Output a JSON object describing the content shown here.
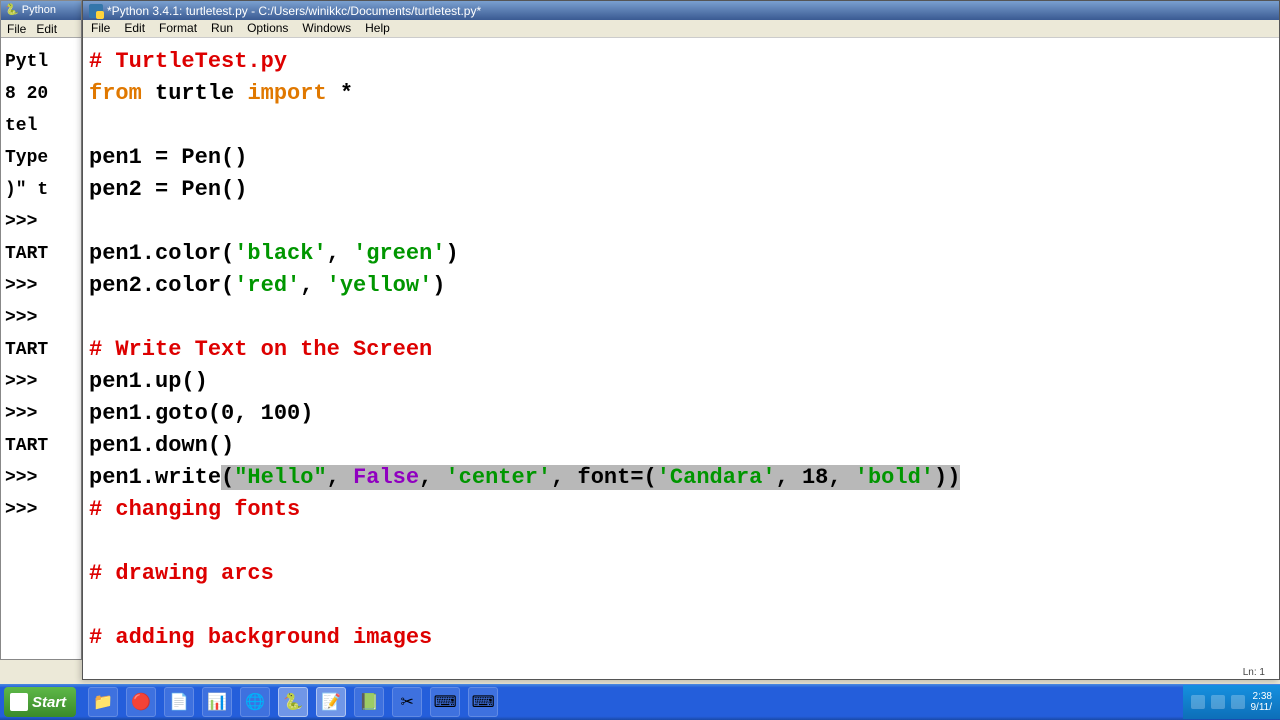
{
  "shell": {
    "title": "Python",
    "menu": {
      "file": "File",
      "edit": "Edit"
    },
    "lines": {
      "l1": "Pytl",
      "l2": "8 20",
      "l3": "tel",
      "l4": "",
      "l5": "Type",
      "l6": ")\" t",
      "l7": "",
      "l8": ">>>",
      "l9": "TART",
      "l10": ">>>",
      "l11": "",
      "l12": ">>>",
      "l13": "TART",
      "l14": ">>>",
      "l15": ">>>",
      "l16": "TART",
      "l17": ">>>",
      "l18": ">>>"
    }
  },
  "editor": {
    "title": "*Python 3.4.1: turtletest.py - C:/Users/winikkc/Documents/turtletest.py*",
    "menu": {
      "file": "File",
      "edit": "Edit",
      "format": "Format",
      "run": "Run",
      "options": "Options",
      "windows": "Windows",
      "help": "Help"
    },
    "status": "Ln: 1",
    "code": {
      "l1_comment": "# TurtleTest.py",
      "l2_kw_from": "from",
      "l2_turtle": " turtle ",
      "l2_kw_import": "import",
      "l2_star": " *",
      "l4": "pen1 = Pen()",
      "l5": "pen2 = Pen()",
      "l7_pre": "pen1.color(",
      "l7_s1": "'black'",
      "l7_mid": ", ",
      "l7_s2": "'green'",
      "l7_post": ")",
      "l8_pre": "pen2.color(",
      "l8_s1": "'red'",
      "l8_mid": ", ",
      "l8_s2": "'yellow'",
      "l8_post": ")",
      "l10_comment": "# Write Text on the Screen",
      "l11": "pen1.up()",
      "l12": "pen1.goto(0, 100)",
      "l13": "pen1.down()",
      "l14_pre": "pen1.write",
      "l14_hl_open": "(",
      "l14_s1": "\"Hello\"",
      "l14_c1": ", ",
      "l14_kw_false": "False",
      "l14_c2": ", ",
      "l14_s2": "'center'",
      "l14_c3": ", font=(",
      "l14_s3": "'Candara'",
      "l14_c4": ", 18, ",
      "l14_s4": "'bold'",
      "l14_close": "))",
      "l15_comment": "# changing fonts",
      "l17_comment": "# drawing arcs",
      "l19_comment": "# adding background images"
    }
  },
  "taskbar": {
    "start": "Start",
    "clock_time": "2:38",
    "clock_date": "9/11/",
    "icons": {
      "i1": "📁",
      "i2": "🔴",
      "i3": "📄",
      "i4": "📊",
      "i5": "🌐",
      "i6": "🐍",
      "i7": "📝",
      "i8": "📗",
      "i9": "✂",
      "i10": "⌨",
      "i11": "⌨"
    }
  }
}
